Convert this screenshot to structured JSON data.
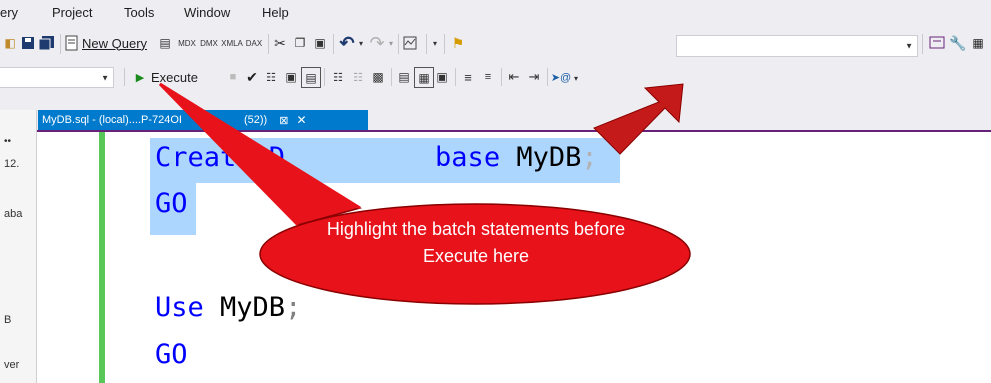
{
  "menu": {
    "items": [
      "ery",
      "Project",
      "Tools",
      "Window",
      "Help"
    ]
  },
  "toolbar1": {
    "new_query_label": "New Query"
  },
  "toolbar2": {
    "execute_label": "Execute"
  },
  "left_pane": {
    "rows": [
      "12.",
      "aba",
      "B",
      "ver"
    ]
  },
  "tab": {
    "title": "MyDB.sql - (local)....P-724OI",
    "suffix": "(52))"
  },
  "editor": {
    "lines": [
      {
        "keyword": "Create D",
        "keyword2": "base",
        "ident": " MyDB",
        "punct": ";"
      },
      {
        "keyword": "GO"
      },
      {
        "keyword": "Use",
        "ident": " MyDB",
        "punct": ";"
      },
      {
        "keyword": "GO"
      }
    ]
  },
  "callout": {
    "text": "Highlight the batch statements before Execute here"
  },
  "colors": {
    "accent": "#007acc",
    "selection": "#add6ff",
    "keyword": "#0000ff",
    "callout": "#e8121b",
    "gutter": "#57c857"
  }
}
